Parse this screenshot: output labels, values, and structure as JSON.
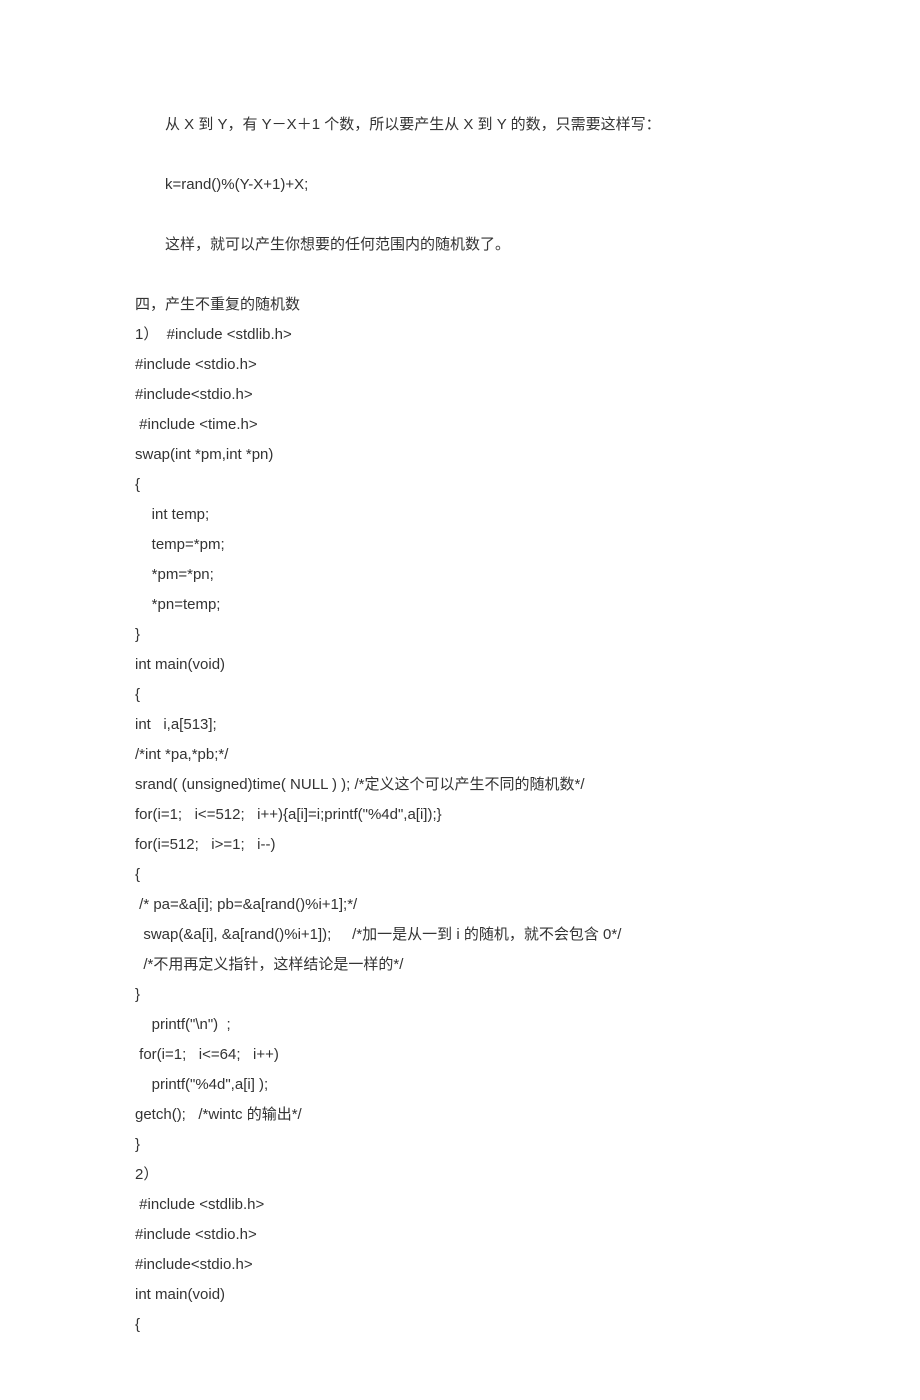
{
  "lines": {
    "p1": "从 X 到 Y，有 Y－X＋1 个数，所以要产生从 X 到 Y 的数，只需要这样写：",
    "p2": "k=rand()%(Y-X+1)+X;",
    "p3": "这样，就可以产生你想要的任何范围内的随机数了。",
    "l1": "四，产生不重复的随机数",
    "l2": "1）  #include <stdlib.h>",
    "l3": "#include <stdio.h>",
    "l4": "#include<stdio.h>",
    "l5": " #include <time.h>",
    "l6": "swap(int *pm,int *pn)",
    "l7": "{",
    "l8": "    int temp;",
    "l9": "    temp=*pm;",
    "l10": "    *pm=*pn;",
    "l11": "    *pn=temp;",
    "l12": "}",
    "l13": "",
    "l14": "int main(void)",
    "l15": "{",
    "l16": "int   i,a[513];",
    "l17": "/*int *pa,*pb;*/",
    "l18": "srand( (unsigned)time( NULL ) ); /*定义这个可以产生不同的随机数*/",
    "l19": "for(i=1;   i<=512;   i++){a[i]=i;printf(\"%4d\",a[i]);}",
    "l20": "for(i=512;   i>=1;   i--)",
    "l21": "{",
    "l22": " /* pa=&a[i]; pb=&a[rand()%i+1];*/",
    "l23": "  swap(&a[i], &a[rand()%i+1]);     /*加一是从一到 i 的随机，就不会包含 0*/",
    "l24": "  /*不用再定义指针，这样结论是一样的*/",
    "l25": "}",
    "l26": "    printf(\"\\n\")  ;",
    "l27": " for(i=1;   i<=64;   i++)",
    "l28": "    printf(\"%4d\",a[i] );",
    "l29": "getch();   /*wintc 的输出*/",
    "l30": "}",
    "l31": "",
    "l32": "2）",
    "l33": " #include <stdlib.h>",
    "l34": "#include <stdio.h>",
    "l35": "#include<stdio.h>",
    "l36": "",
    "l37": "",
    "l38": "int main(void)",
    "l39": "{"
  }
}
